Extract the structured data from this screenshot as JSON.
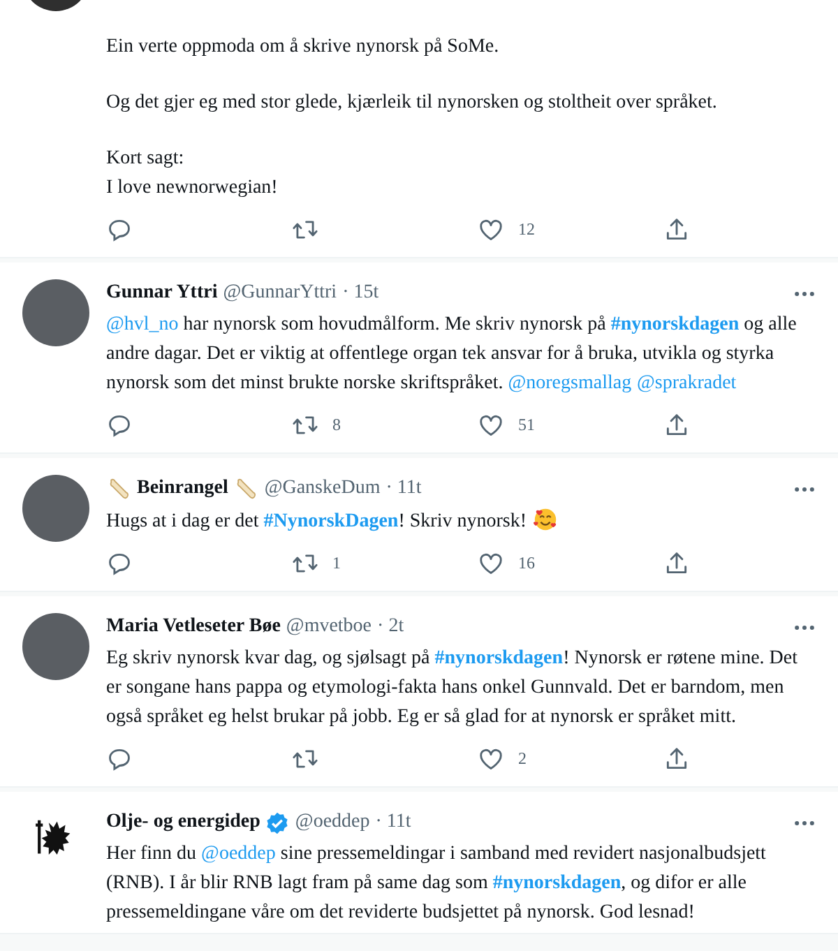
{
  "tweets": [
    {
      "avatar": {
        "kind": "photo"
      },
      "paragraphs": [
        [
          {
            "kind": "text",
            "text": "Ein verte oppmoda om å skrive nynorsk på SoMe."
          }
        ],
        [
          {
            "kind": "text",
            "text": "Og det gjer eg med stor glede, kjærleik til nynorsken og stoltheit over språket."
          }
        ],
        [
          {
            "kind": "text",
            "text": "Kort sagt:\nI love newnorwegian!"
          }
        ]
      ],
      "likes": "12"
    },
    {
      "author": {
        "name": "Gunnar Yttri",
        "handle": "@GunnarYttri",
        "time": "· 15t",
        "verified": false
      },
      "avatar": {
        "kind": "photo"
      },
      "paragraphs": [
        [
          {
            "kind": "mention",
            "text": "@hvl_no"
          },
          {
            "kind": "text",
            "text": " har nynorsk som hovudmålform. Me skriv nynorsk på "
          },
          {
            "kind": "hashtag",
            "text": "#nynorskdagen"
          },
          {
            "kind": "text",
            "text": " og alle andre dagar. Det er viktig at offentlege organ tek ansvar for å bruka, utvikla og styrka nynorsk som det minst brukte norske skriftspråket. "
          },
          {
            "kind": "mention",
            "text": "@noregsmallag"
          },
          {
            "kind": "mention",
            "text": "@sprakradet"
          }
        ]
      ],
      "retweets": "8",
      "likes": "51"
    },
    {
      "author": {
        "name": "Beinrangel",
        "handle": "@GanskeDum",
        "time": "· 11t",
        "verified": false,
        "decoration": {
          "kind": "bone"
        }
      },
      "avatar": {
        "kind": "photo"
      },
      "paragraphs": [
        [
          {
            "kind": "text",
            "text": "Hugs at i dag er det "
          },
          {
            "kind": "hashtag",
            "text": "#NynorskDagen"
          },
          {
            "kind": "text",
            "text": "! Skriv nynorsk! "
          },
          {
            "kind": "emoji"
          }
        ]
      ],
      "retweets": "1",
      "likes": "16"
    },
    {
      "author": {
        "name": "Maria Vetleseter Bøe",
        "handle": "@mvetboe",
        "time": "· 2t",
        "verified": false
      },
      "avatar": {
        "kind": "photo"
      },
      "paragraphs": [
        [
          {
            "kind": "text",
            "text": "Eg skriv nynorsk kvar dag, og sjølsagt på "
          },
          {
            "kind": "hashtag",
            "text": "#nynorskdagen"
          },
          {
            "kind": "text",
            "text": "! Nynorsk er røtene mine. Det er songane hans pappa og etymologi-fakta hans onkel Gunnvald. Det er barndom, men også språket eg helst brukar på jobb. Eg er så glad for at nynorsk er språket mitt."
          }
        ]
      ],
      "likes": "2"
    },
    {
      "author": {
        "name": "Olje- og energidep",
        "handle": "@oeddep",
        "time": "· 11t",
        "verified": true
      },
      "avatar": {
        "kind": "crest"
      },
      "paragraphs": [
        [
          {
            "kind": "text",
            "text": "Her finn du "
          },
          {
            "kind": "mention",
            "text": "@oeddep"
          },
          {
            "kind": "text",
            "text": " sine pressemeldingar i samband med revidert nasjonalbudsjett (RNB). I år blir RNB lagt fram på same dag som "
          },
          {
            "kind": "hashtag",
            "text": "#nynorskdagen"
          },
          {
            "kind": "text",
            "text": ", og difor er alle pressemeldingane våre om det reviderte budsjettet på nynorsk. God lesnad!"
          }
        ]
      ],
      "no_actions": true
    }
  ]
}
